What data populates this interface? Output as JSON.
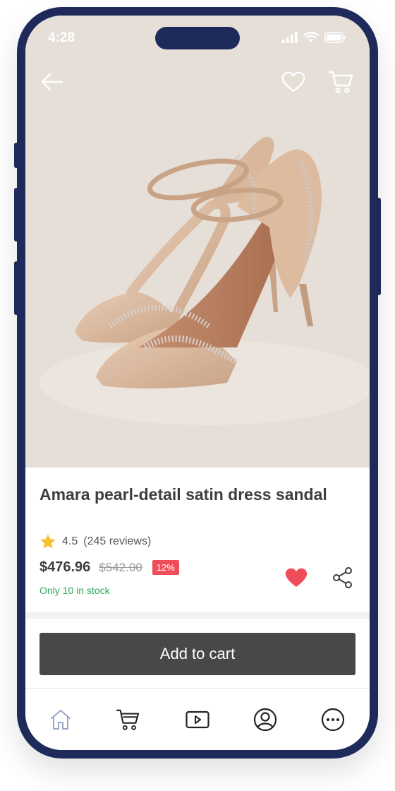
{
  "status_bar": {
    "time": "4:28"
  },
  "top_nav": {
    "back_icon": "arrow-left-icon",
    "favorite_icon": "heart-outline-icon",
    "cart_icon": "cart-icon"
  },
  "product": {
    "title": "Amara pearl-detail satin dress sandal",
    "rating": "4.5",
    "reviews": "(245 reviews)",
    "price": "$476.96",
    "original_price": "$542.00",
    "discount": "12%",
    "stock": "Only 10 in stock"
  },
  "actions": {
    "add_to_cart": "Add to cart"
  },
  "tabbar": {
    "items": [
      {
        "name": "home",
        "icon": "home-icon",
        "active": true
      },
      {
        "name": "cart",
        "icon": "cart-icon"
      },
      {
        "name": "video",
        "icon": "play-icon"
      },
      {
        "name": "profile",
        "icon": "user-circle-icon"
      },
      {
        "name": "more",
        "icon": "more-horizontal-icon"
      }
    ]
  },
  "colors": {
    "frame": "#1e2a5a",
    "discount": "#ef4d5a",
    "stock": "#2eaa5a",
    "button": "#484848",
    "heart": "#ef4d5a"
  }
}
